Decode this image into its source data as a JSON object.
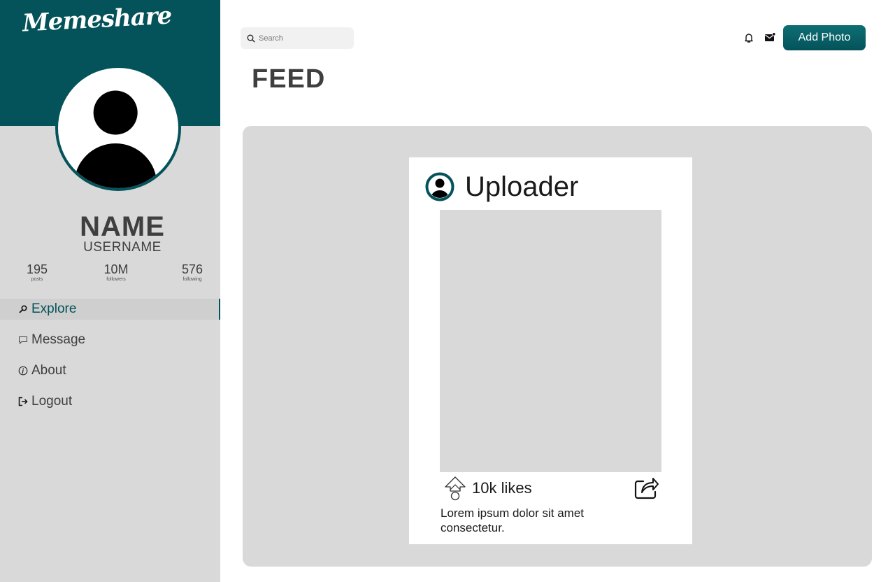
{
  "app": {
    "logo": "Memeshare"
  },
  "profile": {
    "name": "NAME",
    "username": "USERNAME",
    "stats": [
      {
        "value": "195",
        "label": "posts"
      },
      {
        "value": "10M",
        "label": "followers"
      },
      {
        "value": "576",
        "label": "following"
      }
    ]
  },
  "nav": {
    "items": [
      {
        "label": "Explore",
        "icon": "search-icon",
        "active": true
      },
      {
        "label": "Message",
        "icon": "chat-icon",
        "active": false
      },
      {
        "label": "About",
        "icon": "info-icon",
        "active": false
      },
      {
        "label": "Logout",
        "icon": "logout-icon",
        "active": false
      }
    ]
  },
  "header": {
    "search_placeholder": "Search",
    "add_photo_label": "Add Photo",
    "icons": [
      "bell-icon",
      "mail-icon"
    ]
  },
  "page": {
    "title": "FEED"
  },
  "post": {
    "uploader": "Uploader",
    "likes": "10k likes",
    "caption": "Lorem ipsum dolor sit amet consectetur."
  },
  "colors": {
    "brand": "#04525a",
    "sidebar_bg": "#d9d9d9",
    "feed_bg": "#d9d9d9"
  }
}
